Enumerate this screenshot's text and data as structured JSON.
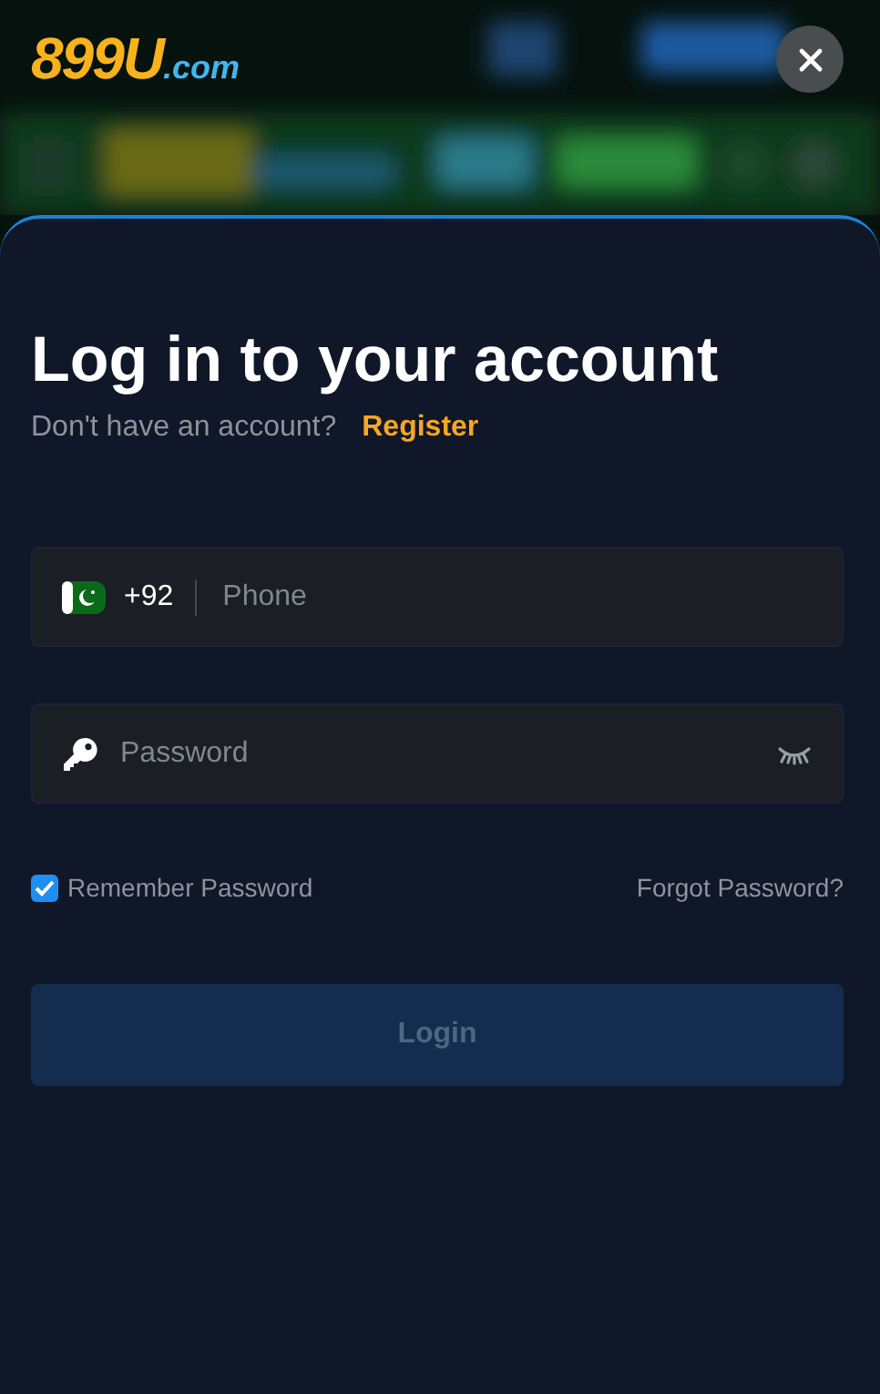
{
  "header": {
    "logo": {
      "main": "899U",
      "suffix": ".com"
    }
  },
  "login": {
    "title": "Log in to your account",
    "prompt": "Don't have an account?",
    "register_link": "Register",
    "phone": {
      "country_code": "+92",
      "placeholder": "Phone"
    },
    "password": {
      "placeholder": "Password"
    },
    "remember": {
      "label": "Remember Password",
      "checked": true
    },
    "forgot_link": "Forgot Password?",
    "submit": {
      "label": "Login",
      "disabled": true
    }
  }
}
